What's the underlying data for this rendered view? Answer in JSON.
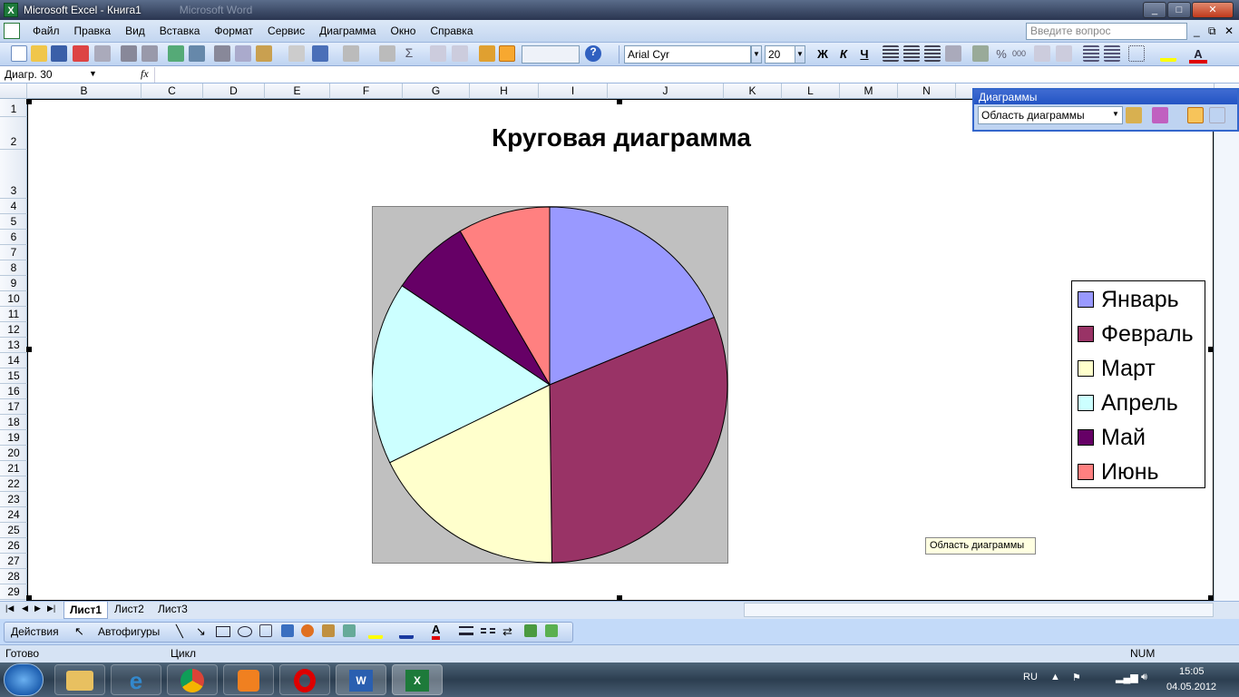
{
  "window": {
    "title": "Microsoft Excel - Книга1",
    "ghost_title": "Microsoft Word",
    "min": "_",
    "max": "□",
    "close": "✕"
  },
  "menu": [
    "Файл",
    "Правка",
    "Вид",
    "Вставка",
    "Формат",
    "Сервис",
    "Диаграмма",
    "Окно",
    "Справка"
  ],
  "ask": {
    "placeholder": "Введите вопрос"
  },
  "format": {
    "font": "Arial Cyr",
    "size": "20",
    "bold": "Ж",
    "italic": "К",
    "underline": "Ч"
  },
  "namebox": "Диагр. 30",
  "fx": "fx",
  "columns": [
    "B",
    "C",
    "D",
    "E",
    "F",
    "G",
    "H",
    "I",
    "J",
    "K",
    "L",
    "M",
    "N"
  ],
  "rows": [
    "1",
    "2",
    "3",
    "4",
    "5",
    "6",
    "7",
    "8",
    "9",
    "10",
    "11",
    "12",
    "13",
    "14",
    "15",
    "16",
    "17",
    "18",
    "19",
    "20",
    "21",
    "22",
    "23",
    "24",
    "25",
    "26",
    "27",
    "28",
    "29"
  ],
  "chart_toolbar": {
    "title": "Диаграммы",
    "selection": "Область диаграммы"
  },
  "chart_data": {
    "type": "pie",
    "title": "Круговая диаграмма",
    "categories": [
      "Январь",
      "Февраль",
      "Март",
      "Апрель",
      "Май",
      "Июнь"
    ],
    "values": [
      18.8,
      31.0,
      18.0,
      16.6,
      7.2,
      8.4
    ],
    "colors": [
      "#9999ff",
      "#993366",
      "#ffffcc",
      "#ccffff",
      "#660066",
      "#ff8080"
    ],
    "legend": "right"
  },
  "tooltip": "Область диаграммы",
  "sheets": [
    "Лист1",
    "Лист2",
    "Лист3"
  ],
  "drawing": {
    "actions": "Действия",
    "autoshapes": "Автофигуры"
  },
  "status": {
    "ready": "Готово",
    "mode": "Цикл",
    "num": "NUM"
  },
  "tray": {
    "lang": "RU",
    "time": "15:05",
    "date": "04.05.2012"
  }
}
